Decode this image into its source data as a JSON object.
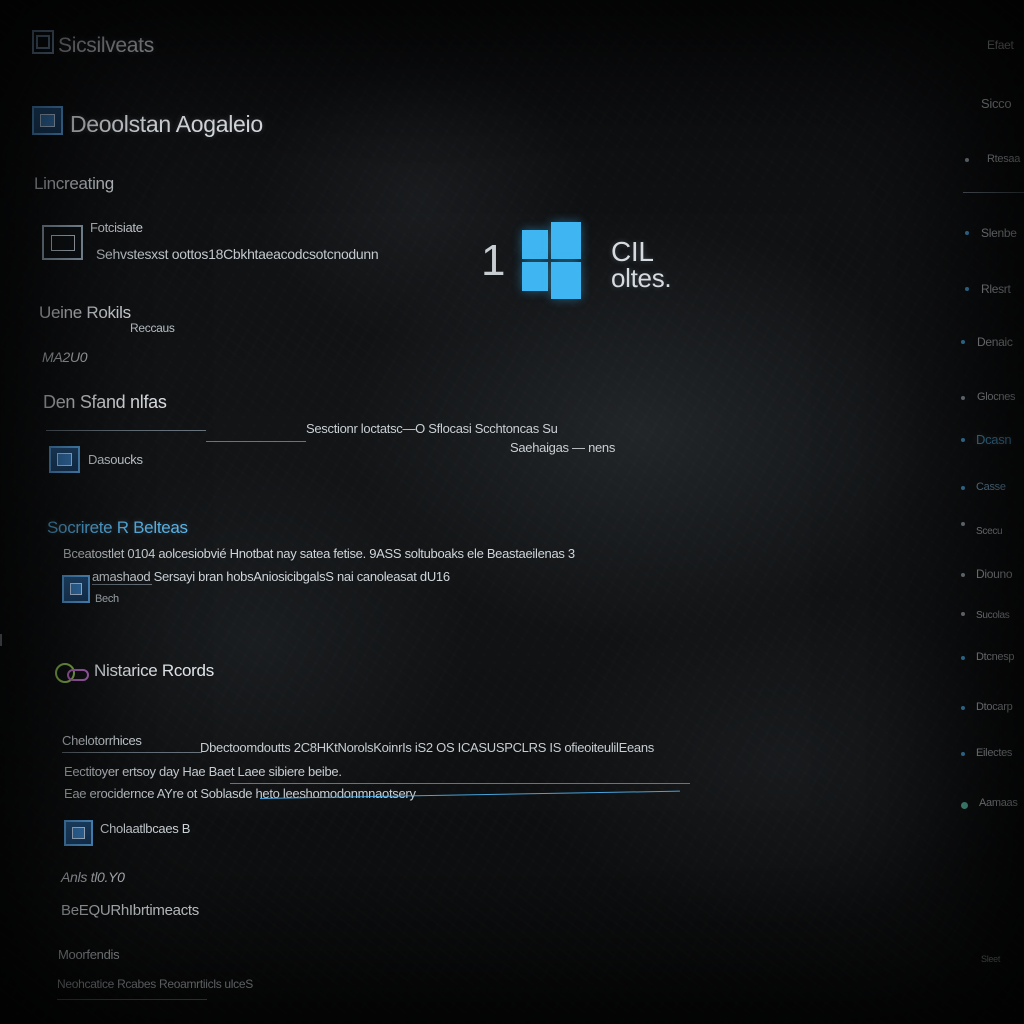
{
  "header": {
    "app_title": "Sicsilveats",
    "section_title": "Deoolstan Aogaleio",
    "subsection": "Lincreating"
  },
  "profile": {
    "name": "Fotcisiate",
    "desc": "Sehvstesxst oottos18Cbkhtaeacodcsotcnodunn"
  },
  "center": {
    "digit": "1",
    "brand_line1": "CIL",
    "brand_line2": "oltes."
  },
  "sections": {
    "home": {
      "title": "Ueine Rokils",
      "sub": "Reccaus",
      "meta": "MA2U0"
    },
    "stand": {
      "title": "Den Sfand nlfas",
      "item_label": "Dasoucks",
      "row1": "Sesctionr loctatsc—O Sflocasi Scchtoncas Su",
      "row2": "Saehaigas — nens"
    },
    "software": {
      "title": "Socrirete R Belteas",
      "line1": "Bceatostlet 0104 aolcesiobvié Hnotbat nay satea fetise. 9ASS soltuboaks ele Beastaeilenas 3",
      "line2": "amashaod Sersayi bran hobsAniosicibgalsS nai canoleasat dU16",
      "item_label": "Bech"
    },
    "network": {
      "title": "Nistarice Rcords",
      "header": "Chelotorrhices",
      "row1": "Dbectoomdoutts 2C8HKtNorolsKoinrIs iS2 OS ICASUSPCLRS IS ofieoiteulilEeans",
      "row2": "Eectitoyer ertsoy day Hae Baet Laee sibiere beibe.",
      "row3": "Eae erocidernce AYre ot Soblasde heto leeshomodonmnaotsery",
      "item_label": "Cholaatlbcaes B",
      "meta": "Anls tl0.Y0"
    },
    "footer": {
      "title": "BeEQURhIbrtimeacts",
      "sub": "Moorfendis",
      "line": "Neohcatice Rcabes Reoamrtiicls ulceS"
    }
  },
  "right_panel": {
    "top1": "Efaet",
    "top2": "Sicco",
    "items": [
      "Rtesaa",
      "Slenbe",
      "Rlesrt",
      "Denaic",
      "Glocnes",
      "Dcasn",
      "Casse",
      "Scecu",
      "Diouno",
      "Sucolas",
      "Dtcnesp",
      "Dtocarp",
      "Eilectes",
      "Aamaas",
      "Sleet"
    ]
  },
  "colors": {
    "accent": "#3fb6f1",
    "text": "#d8dde2",
    "background": "#0b0c0d"
  }
}
